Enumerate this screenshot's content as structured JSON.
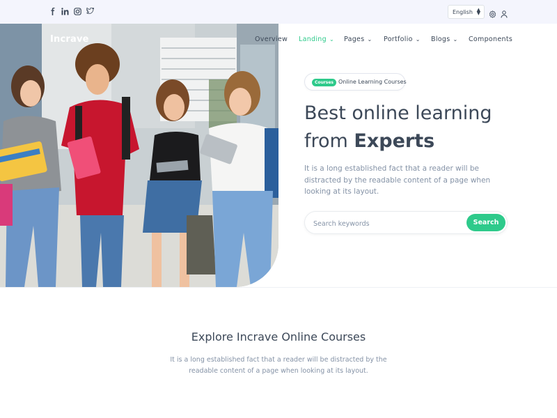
{
  "topbar": {
    "social_icons": [
      "facebook-icon",
      "linkedin-icon",
      "instagram-icon",
      "twitter-icon"
    ],
    "language": {
      "selected": "English"
    },
    "icons": [
      "settings-icon",
      "user-icon"
    ]
  },
  "brand": {
    "name": "Incrave"
  },
  "nav": {
    "items": [
      {
        "label": "Overview",
        "active": false,
        "dropdown": false
      },
      {
        "label": "Landing",
        "active": true,
        "dropdown": true
      },
      {
        "label": "Pages",
        "active": false,
        "dropdown": true
      },
      {
        "label": "Portfolio",
        "active": false,
        "dropdown": true
      },
      {
        "label": "Blogs",
        "active": false,
        "dropdown": true
      },
      {
        "label": "Components",
        "active": false,
        "dropdown": false
      }
    ]
  },
  "hero": {
    "badge": "Courses",
    "badge_text": "Online Learning Courses",
    "title_line1": "Best online learning",
    "title_line2_prefix": "from ",
    "title_line2_bold": "Experts",
    "description": "It is a long established fact that a reader will be distracted by the readable content of a page when looking at its layout.",
    "search": {
      "placeholder": "Search keywords",
      "value": "",
      "button": "Search"
    }
  },
  "section": {
    "title": "Explore Incrave Online Courses",
    "text": "It is a long established fact that a reader will be distracted by the readable content of a page when looking at its layout."
  },
  "colors": {
    "accent": "#2eca8b",
    "text": "#3c4858",
    "muted": "#8492a6",
    "topbar_bg": "#f4f5fd"
  }
}
